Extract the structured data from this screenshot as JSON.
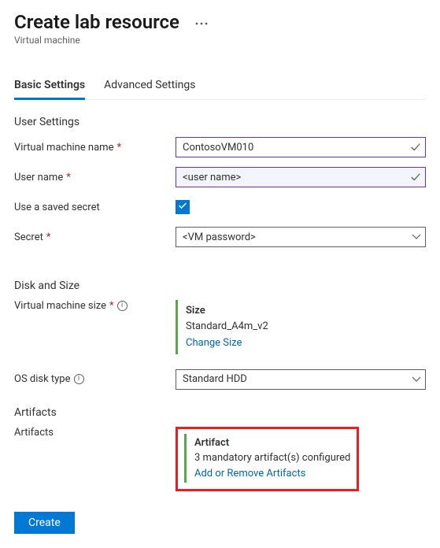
{
  "header": {
    "title": "Create lab resource",
    "subtitle": "Virtual machine",
    "more_icon": "more-horizontal"
  },
  "tabs": {
    "basic": "Basic Settings",
    "advanced": "Advanced Settings"
  },
  "user_settings": {
    "title": "User Settings",
    "vm_name_label": "Virtual machine name",
    "vm_name_value": "ContosoVM010",
    "user_name_label": "User name",
    "user_name_placeholder": "<user name>",
    "saved_secret_label": "Use a saved secret",
    "saved_secret_checked": true,
    "secret_label": "Secret",
    "secret_placeholder": "<VM password>"
  },
  "disk_size": {
    "title": "Disk and Size",
    "vm_size_label": "Virtual machine size",
    "size_heading": "Size",
    "size_value": "Standard_A4m_v2",
    "change_size_link": "Change Size",
    "os_disk_label": "OS disk type",
    "os_disk_value": "Standard HDD"
  },
  "artifacts": {
    "section_title": "Artifacts",
    "row_label": "Artifacts",
    "heading": "Artifact",
    "status": "3 mandatory artifact(s) configured",
    "link": "Add or Remove Artifacts"
  },
  "footer": {
    "create_label": "Create"
  }
}
